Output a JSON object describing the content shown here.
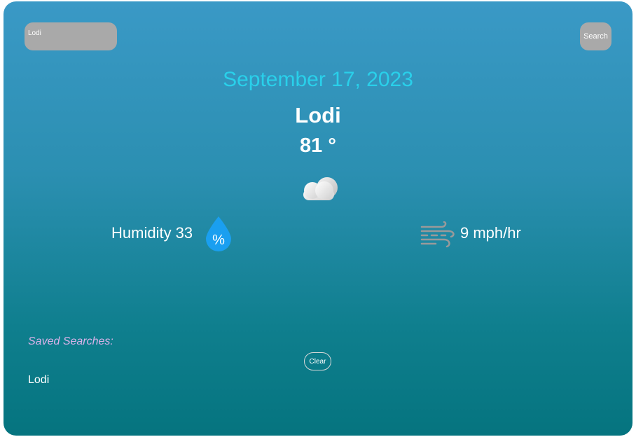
{
  "search": {
    "input_value": "Lodi",
    "button_label": "Search"
  },
  "weather": {
    "date": "September 17, 2023",
    "city": "Lodi",
    "temperature": "81 °",
    "condition_icon": "cloud-icon",
    "humidity_label": "Humidity 33",
    "humidity_icon": "humidity-drop-icon",
    "humidity_icon_glyph": "%",
    "wind_icon": "wind-icon",
    "wind_label": "9 mph/hr"
  },
  "saved": {
    "title": "Saved Searches:",
    "clear_label": "Clear",
    "items": [
      "Lodi"
    ]
  },
  "colors": {
    "gradient_top": "#3a99c6",
    "gradient_bottom": "#05747f",
    "date_accent": "#29d0ea",
    "saved_title": "#dcb3ea",
    "button_gray": "#a9a9a9",
    "drop_blue": "#1a9ff0"
  }
}
